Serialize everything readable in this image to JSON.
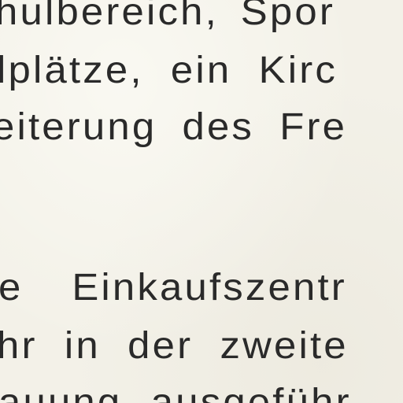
{
  "paragraph_1": {
    "line_1": "hulbereich, Spor",
    "line_2": "lplätze, ein Kirc",
    "line_3": "eiterung des Fre"
  },
  "paragraph_2": {
    "line_1": "e Einkaufszentr",
    "line_2": "hr in der zweite",
    "line_3": "auung ausgeführ"
  }
}
